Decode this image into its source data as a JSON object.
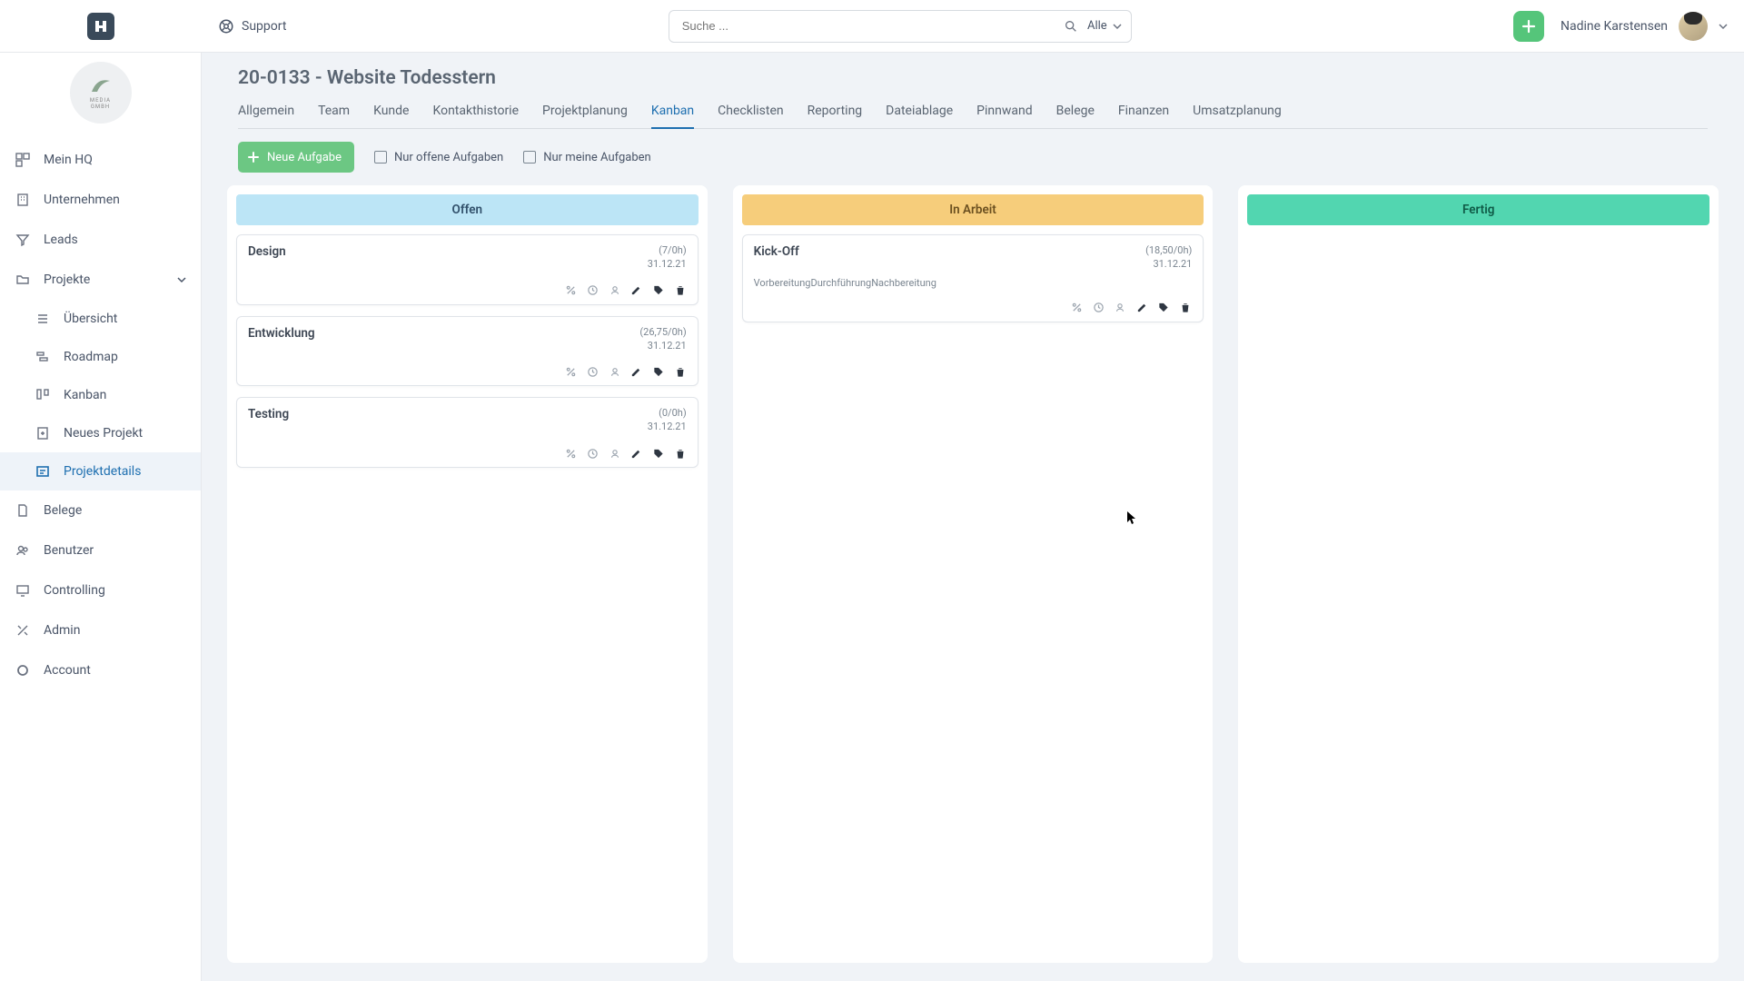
{
  "header": {
    "support_label": "Support",
    "search_placeholder": "Suche ...",
    "search_scope": "Alle",
    "user_name": "Nadine Karstensen"
  },
  "brand": {
    "line1": "MEDIA",
    "line2": "GMBH"
  },
  "sidebar": {
    "items": [
      {
        "label": "Mein HQ"
      },
      {
        "label": "Unternehmen"
      },
      {
        "label": "Leads"
      },
      {
        "label": "Projekte",
        "expanded": true,
        "children": [
          {
            "label": "Übersicht"
          },
          {
            "label": "Roadmap"
          },
          {
            "label": "Kanban"
          },
          {
            "label": "Neues Projekt"
          },
          {
            "label": "Projektdetails",
            "active": true
          }
        ]
      },
      {
        "label": "Belege"
      },
      {
        "label": "Benutzer"
      },
      {
        "label": "Controlling"
      },
      {
        "label": "Admin"
      },
      {
        "label": "Account"
      }
    ]
  },
  "page": {
    "title": "20-0133 - Website Todesstern"
  },
  "tabs": [
    "Allgemein",
    "Team",
    "Kunde",
    "Kontakthistorie",
    "Projektplanung",
    "Kanban",
    "Checklisten",
    "Reporting",
    "Dateiablage",
    "Pinnwand",
    "Belege",
    "Finanzen",
    "Umsatzplanung"
  ],
  "active_tab": "Kanban",
  "toolbar": {
    "new_task": "Neue Aufgabe",
    "only_open": "Nur offene Aufgaben",
    "only_mine": "Nur meine Aufgaben"
  },
  "columns": [
    {
      "title": "Offen",
      "style": "open",
      "cards": [
        {
          "title": "Design",
          "hours": "(7/0h)",
          "date": "31.12.21"
        },
        {
          "title": "Entwicklung",
          "hours": "(26,75/0h)",
          "date": "31.12.21"
        },
        {
          "title": "Testing",
          "hours": "(0/0h)",
          "date": "31.12.21"
        }
      ]
    },
    {
      "title": "In Arbeit",
      "style": "work",
      "cards": [
        {
          "title": "Kick-Off",
          "hours": "(18,50/0h)",
          "date": "31.12.21",
          "sub": "VorbereitungDurchführungNachbereitung"
        }
      ]
    },
    {
      "title": "Fertig",
      "style": "done",
      "cards": []
    }
  ]
}
